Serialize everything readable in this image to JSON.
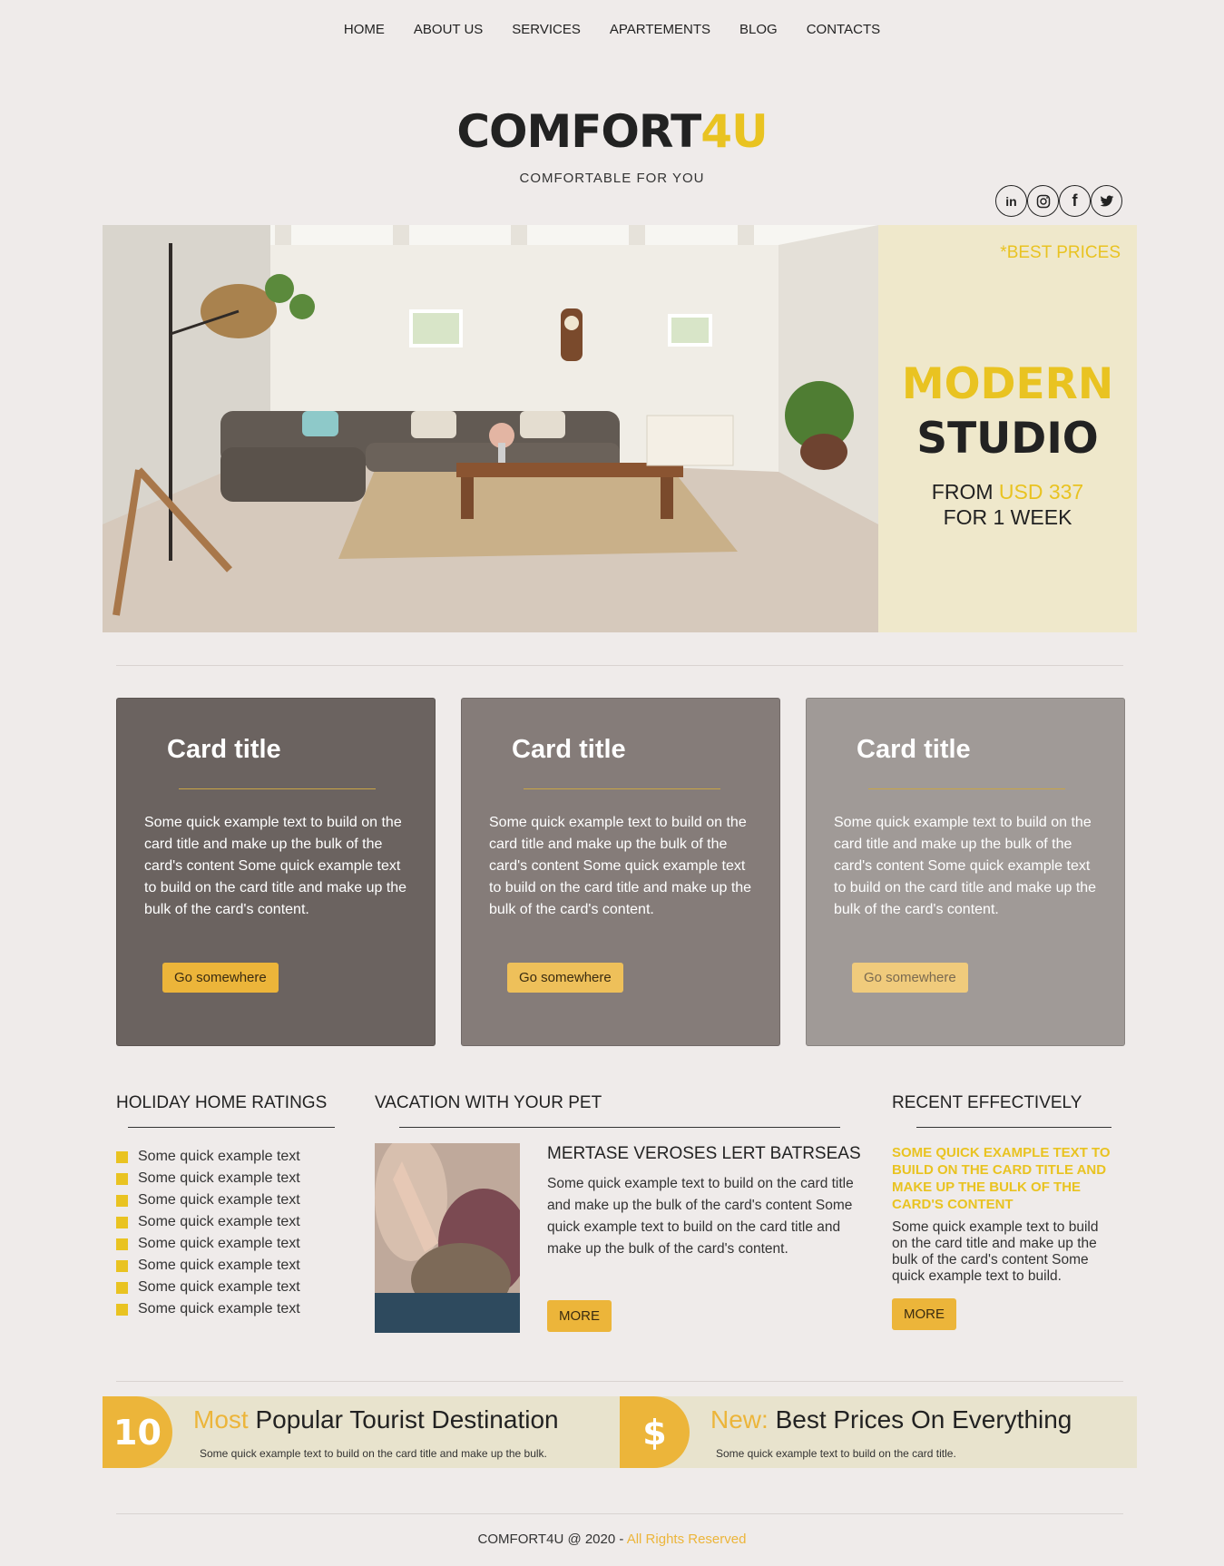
{
  "nav": [
    "HOME",
    "ABOUT US",
    "SERVICES",
    "APARTEMENTS",
    "BLOG",
    "CONTACTS"
  ],
  "brand": {
    "name_main": "COMFORT",
    "name_accent": "4U",
    "tagline": "COMFORTABLE FOR YOU"
  },
  "social": [
    {
      "icon": "linkedin-icon",
      "glyph": "in"
    },
    {
      "icon": "instagram-icon",
      "glyph": "◎"
    },
    {
      "icon": "facebook-icon",
      "glyph": "f"
    },
    {
      "icon": "twitter-icon",
      "glyph": "🐦"
    }
  ],
  "hero": {
    "badge": "*BEST PRICES",
    "title_accent": "MODERN",
    "title_main": "STUDIO",
    "from_label": "FROM",
    "price": "USD 337",
    "period": "FOR 1 WEEK"
  },
  "cards": [
    {
      "title": "Card title",
      "text": "Some quick example text to build on the card title and make up the bulk of the card's content Some quick example text to build on the card title and make up the bulk of the card's content.",
      "button": "Go somewhere",
      "bg": "#6b6360",
      "btn_bg": "#ecb53a"
    },
    {
      "title": "Card title",
      "text": "Some quick example text to build on the card title and make up the bulk of the card's content Some quick example text to build on the card title and make up the bulk of the card's content.",
      "button": "Go somewhere",
      "bg": "#857c79",
      "btn_bg": "#eec05a"
    },
    {
      "title": "Card title",
      "text": "Some quick example text to build on the card title and make up the bulk of the card's content Some quick example text to build on the card title and make up the bulk of the card's content.",
      "button": "Go somewhere",
      "bg": "#a09a97",
      "btn_bg": "#f0cb7c"
    }
  ],
  "ratings": {
    "heading": "HOLIDAY HOME RATINGS",
    "items": [
      "Some quick example text",
      "Some quick example text",
      "Some quick example text",
      "Some quick example text",
      "Some quick example text",
      "Some quick example text",
      "Some quick example text",
      "Some quick example text"
    ]
  },
  "pet": {
    "heading": "VACATION WITH YOUR PET",
    "title": "MERTASE VEROSES LERT BATRSEAS",
    "text": "Some quick example text to build on the card title and make up the bulk of the card's content Some quick example text to build on the card title and make up the bulk of the card's content.",
    "button": "MORE"
  },
  "recent": {
    "heading": "RECENT EFFECTIVELY",
    "highlight": "SOME QUICK EXAMPLE TEXT TO BUILD ON THE CARD TITLE AND MAKE UP THE BULK OF THE CARD'S CONTENT",
    "text": "Some quick example text to build on the card title and make up the bulk of the card's content Some quick example text to build.",
    "button": "MORE"
  },
  "banners": [
    {
      "badge": "10",
      "accent": "Most",
      "title": "Popular Tourist Destination",
      "sub": "Some quick example text to build on the card title and make up the bulk."
    },
    {
      "badge": "$",
      "accent": "New:",
      "title": "Best Prices On Everything",
      "sub": "Some quick example text to build on the card title."
    }
  ],
  "footer": {
    "text": "COMFORT4U @ 2020 -",
    "accent": "All Rights Reserved"
  },
  "colors": {
    "accent": "#e9c321",
    "button": "#ecb53a",
    "background": "#efebea"
  }
}
